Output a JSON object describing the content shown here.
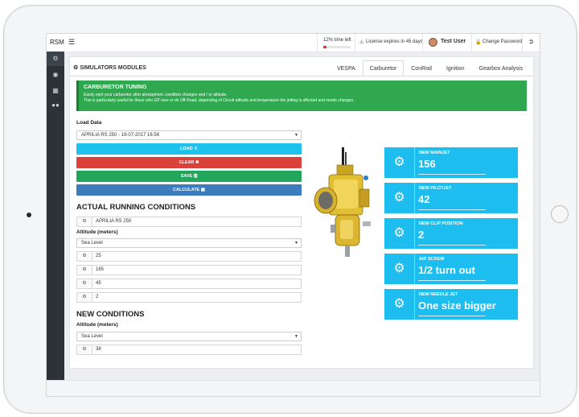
{
  "topbar": {
    "brand": "RSM",
    "menu_icon": "hamburger-icon",
    "time_left": "12% time left",
    "time_progress_percent": 12,
    "license": "License expires in 45 days",
    "user_name": "Test User",
    "change_password": "Change Password",
    "logout_icon": "logout-icon"
  },
  "sidebar": {
    "items": [
      {
        "icon": "cogs-icon"
      },
      {
        "icon": "dashboard-icon"
      },
      {
        "icon": "calculator-icon"
      },
      {
        "icon": "motorcycle-icon"
      }
    ]
  },
  "panel": {
    "title": "SIMULATORS MODULES",
    "tabs": [
      "VESPA",
      "Carburetor",
      "ConRod",
      "Ignition",
      "Gearbox Analysis"
    ],
    "active_tab": "Carburetor"
  },
  "alert": {
    "title": "CARBURETOR TUNING",
    "line1": "Easily rejet your carburetor after atmospheric condition changes and / or altitude.",
    "line2": "This is particularly useful for those who GP race or do Off-Road, depending of Circuit altitude and temperature the jetting is affected and needs changes."
  },
  "load": {
    "label": "Load Data",
    "selected": "APRILIA RS 250 - 19-07-2017 16:56"
  },
  "buttons": {
    "load": "LOAD ⇩",
    "clear": "CLEAR ✖",
    "save": "SAVE 🖫",
    "calculate": "CALCULATE ▦"
  },
  "actual": {
    "heading": "ACTUAL RUNNING CONDITIONS",
    "name_value": "APRILIA RS 250",
    "altitude_label": "Altitude (meters)",
    "altitude_selected": "Sea Level",
    "fields": [
      "25",
      "165",
      "45",
      "2"
    ]
  },
  "new_conditions": {
    "heading": "NEW CONDITIONS",
    "altitude_label": "Altitude (meters)",
    "altitude_selected": "Sea Level",
    "field": "38"
  },
  "results": [
    {
      "label": "NEW MAINJET",
      "value": "156"
    },
    {
      "label": "NEW PILOTJET",
      "value": "42"
    },
    {
      "label": "NEW CLIP POSITION",
      "value": "2"
    },
    {
      "label": "AIR SCREW",
      "value": "1/2 turn out"
    },
    {
      "label": "NEW NEEDLE JET",
      "value": "One size bigger"
    }
  ],
  "colors": {
    "accent_cyan": "#1ebdf0",
    "alert_green": "#2fa84f",
    "clear_red": "#d9413a",
    "save_green": "#22a65c",
    "calc_blue": "#3c7bbd",
    "sidebar_dark": "#2c3237"
  }
}
